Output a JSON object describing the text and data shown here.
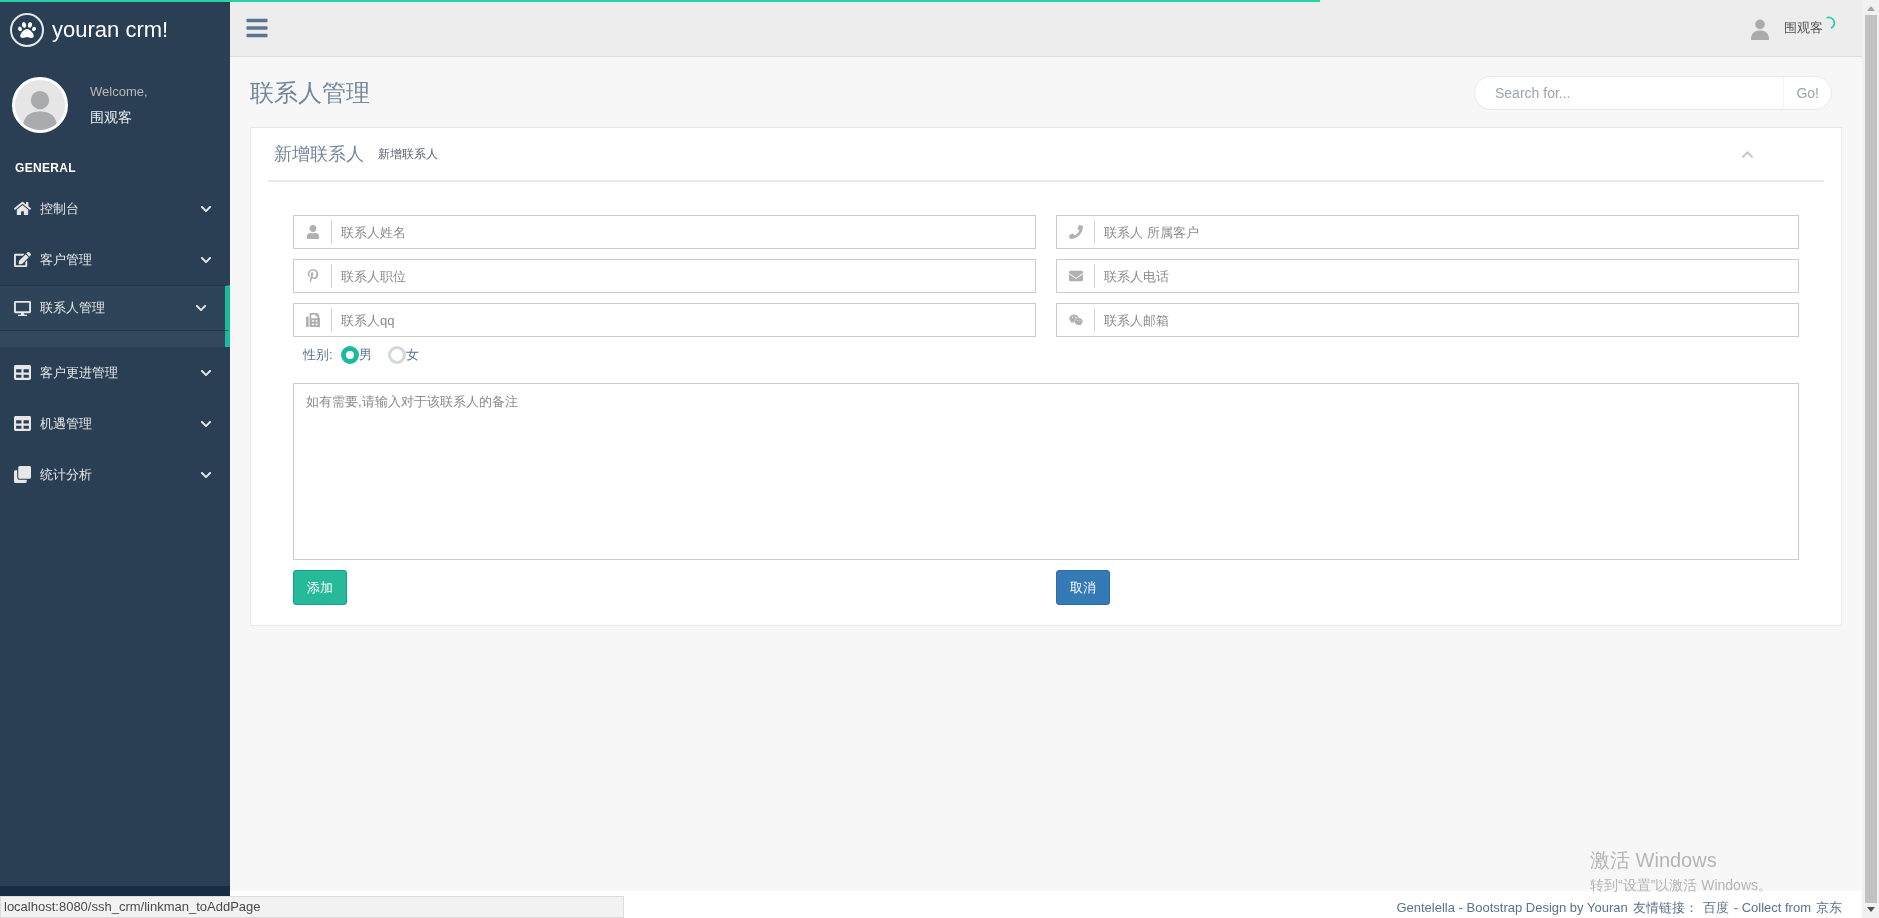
{
  "sidebar": {
    "brand": "youran crm!",
    "welcome": "Welcome,",
    "user": "围观客",
    "section": "GENERAL",
    "items": [
      {
        "label": "控制台",
        "selected": false
      },
      {
        "label": "客户管理",
        "selected": false
      },
      {
        "label": "联系人管理",
        "selected": true
      },
      {
        "label": "客户更进管理",
        "selected": false
      },
      {
        "label": "机遇管理",
        "selected": false
      },
      {
        "label": "统计分析",
        "selected": false
      }
    ]
  },
  "topbar": {
    "user": "围观客"
  },
  "page_title": "联系人管理",
  "search": {
    "placeholder": "Search for...",
    "button": "Go!"
  },
  "panel": {
    "title": "新增联系人",
    "subtitle": "新增联系人",
    "fields": [
      {
        "placeholder": "联系人姓名"
      },
      {
        "placeholder": "联系人 所属客户"
      },
      {
        "placeholder": "联系人职位"
      },
      {
        "placeholder": "联系人电话"
      },
      {
        "placeholder": "联系人qq"
      },
      {
        "placeholder": "联系人邮箱"
      }
    ],
    "gender": {
      "label": "性别:",
      "options": [
        {
          "label": "男",
          "selected": true
        },
        {
          "label": "女",
          "selected": false
        }
      ]
    },
    "remark": {
      "placeholder": "如有需要,请输入对于该联系人的备注"
    },
    "buttons": [
      {
        "label": "添加",
        "kind": "success"
      },
      {
        "label": "取消",
        "kind": "primary"
      }
    ]
  },
  "footer": {
    "credit": "Gentelella - Bootstrap Design by Youran",
    "links_label": "友情链接：",
    "link_1": "百度",
    "middle": "- Collect from",
    "link_2": "京东"
  },
  "status_url": "localhost:8080/ssh_crm/linkman_toAddPage",
  "windows_notice": {
    "title": "激活 Windows",
    "text": "转到“设置”以激活 Windows。"
  }
}
